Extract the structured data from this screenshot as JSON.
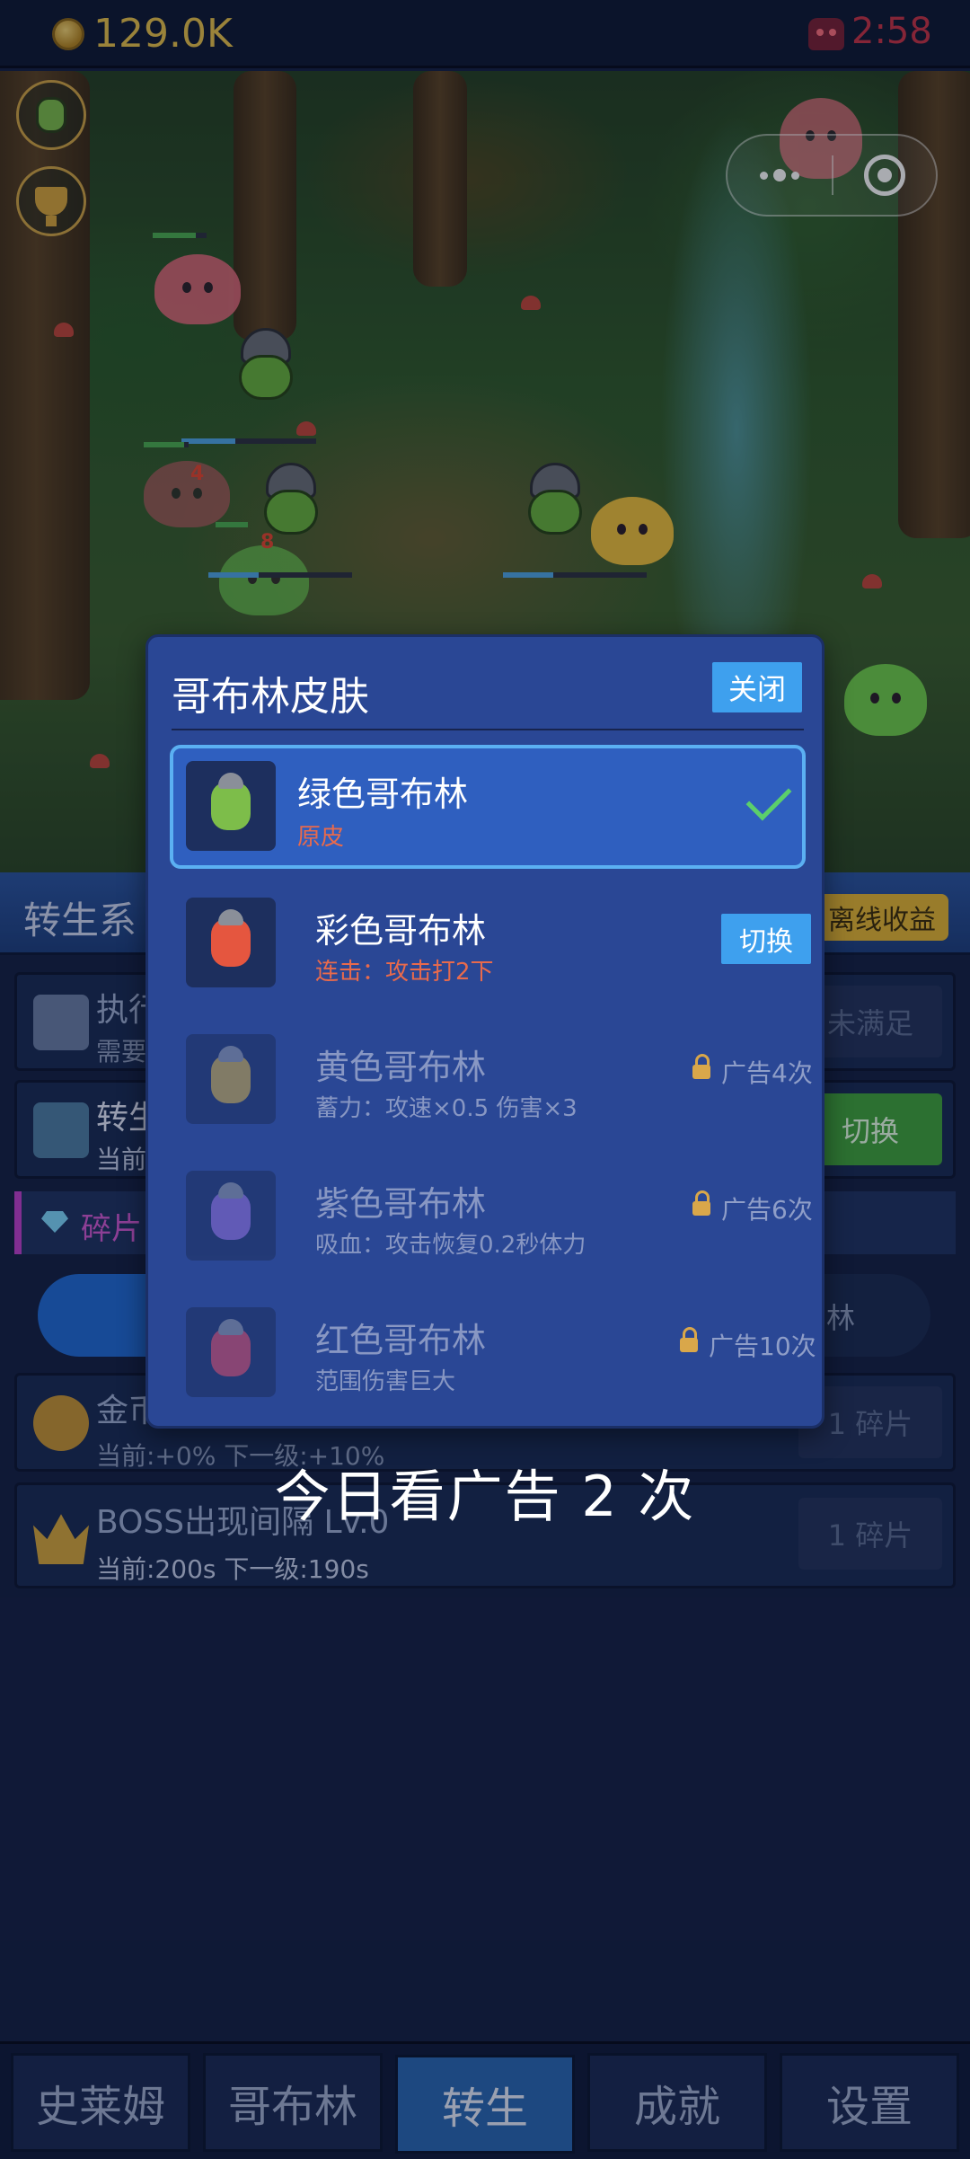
{
  "status": {
    "coins": "129.0K",
    "timer": "2:58"
  },
  "panel": {
    "section_title": "转生系",
    "offline_button": "离线收益",
    "rows": [
      {
        "title": "执行",
        "sub": "需要",
        "button": "未满足"
      },
      {
        "title": "转生",
        "sub": "当前",
        "button": "切换"
      }
    ],
    "fragments_label": "碎片",
    "pill_right_label": "林",
    "upgrades": [
      {
        "title": "金币",
        "sub": "当前:+0%  下一级:+10%",
        "button": "1 碎片"
      },
      {
        "title": "BOSS出现间隔 Lv.0",
        "sub": "当前:200s  下一级:190s",
        "button": "1 碎片"
      }
    ]
  },
  "modal": {
    "title": "哥布林皮肤",
    "close_label": "关闭",
    "skins": [
      {
        "name": "绿色哥布林",
        "desc": "原皮",
        "state": "selected",
        "color": "#7dbd4a"
      },
      {
        "name": "彩色哥布林",
        "desc": "连击：攻击打2下",
        "state": "unlocked",
        "action": "切换",
        "color": "#e5563f"
      },
      {
        "name": "黄色哥布林",
        "desc": "蓄力：攻速×0.5 伤害×3",
        "state": "locked",
        "lock_text": "广告4次",
        "color": "#c9a640"
      },
      {
        "name": "紫色哥布林",
        "desc": "吸血：攻击恢复0.2秒体力",
        "state": "locked",
        "lock_text": "广告6次",
        "color": "#8f6ad2"
      },
      {
        "name": "红色哥布林",
        "desc": "范围伤害巨大",
        "state": "locked",
        "lock_text": "广告10次",
        "color": "#d5455a"
      }
    ]
  },
  "toast": "今日看广告 2 次",
  "tabs": [
    {
      "label": "史莱姆",
      "active": false
    },
    {
      "label": "哥布林",
      "active": false
    },
    {
      "label": "转生",
      "active": true
    },
    {
      "label": "成就",
      "active": false
    },
    {
      "label": "设置",
      "active": false
    }
  ],
  "scene": {
    "damage_numbers": [
      "4",
      "8"
    ]
  },
  "colors": {
    "accent": "#3ea0ee",
    "modal_bg": "#2a4795",
    "coin": "#e8c24a",
    "timer": "#c83246",
    "desc_red": "#e86a4c"
  }
}
